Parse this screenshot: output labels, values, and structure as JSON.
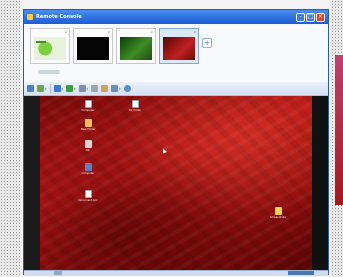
{
  "window": {
    "title": "Remote Console"
  },
  "thumbnails": [
    {
      "label": "",
      "selected": false,
      "image": "green-desktop"
    },
    {
      "label": "",
      "selected": false,
      "image": "black-screen"
    },
    {
      "label": "",
      "selected": false,
      "image": "green-wallpaper"
    },
    {
      "label": "",
      "selected": true,
      "image": "red-wallpaper"
    }
  ],
  "toolbar": {
    "items": [
      {
        "icon": "back-icon",
        "label": ""
      },
      {
        "icon": "refresh-icon",
        "label": ""
      },
      {
        "icon": "monitor-icon",
        "label": ""
      },
      {
        "icon": "tile-icon",
        "label": ""
      },
      {
        "icon": "view-icon",
        "label": ""
      },
      {
        "icon": "fit-icon",
        "label": ""
      },
      {
        "icon": "clipboard-icon",
        "label": ""
      },
      {
        "icon": "capture-icon",
        "label": ""
      },
      {
        "icon": "settings-icon",
        "label": ""
      }
    ]
  },
  "desktop": {
    "icons": [
      {
        "label": "Computer",
        "kind": "document"
      },
      {
        "label": "Ex_folder",
        "kind": "document"
      },
      {
        "label": "New Folder",
        "kind": "folder"
      },
      {
        "label": "Bin",
        "kind": "bin"
      },
      {
        "label": "Computer",
        "kind": "computer"
      },
      {
        "label": "Document.doc",
        "kind": "document"
      },
      {
        "label": "Screenshots",
        "kind": "yellow-folder"
      }
    ]
  },
  "colors": {
    "accent": "#1c5cd4",
    "desktop_red": "#b81616"
  }
}
